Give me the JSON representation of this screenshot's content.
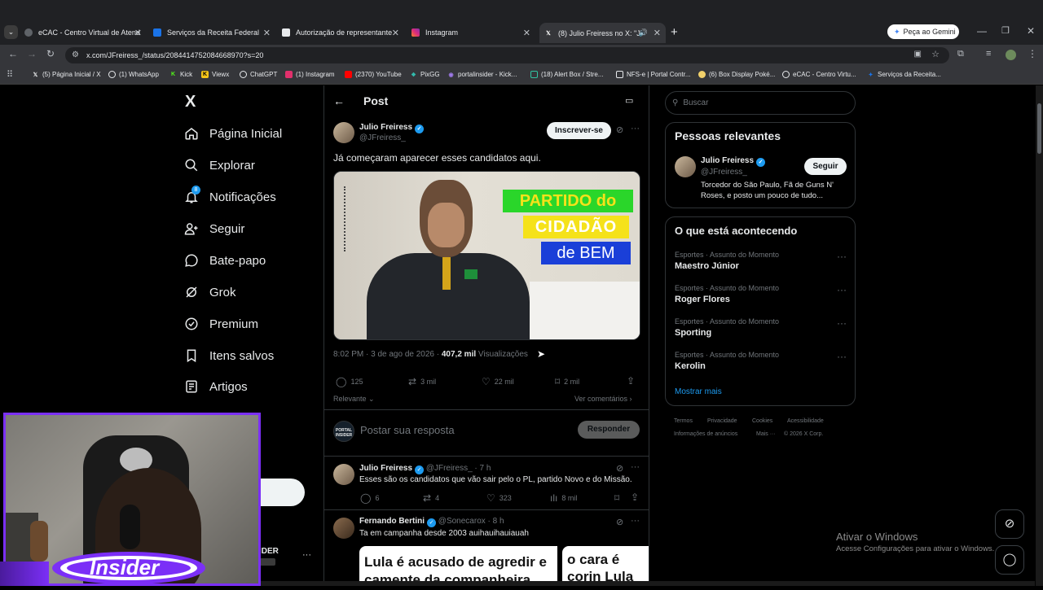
{
  "browser": {
    "tabs": [
      {
        "title": "eCAC - Centro Virtual de Atend",
        "icon": "ecac-icon"
      },
      {
        "title": "Serviços da Receita Federal",
        "icon": "receita-icon"
      },
      {
        "title": "Autorização de representante C",
        "icon": "gov-icon"
      },
      {
        "title": "Instagram",
        "icon": "instagram-icon"
      },
      {
        "title": "(8) Julio Freiress no X: \"Já co",
        "icon": "x-icon"
      }
    ],
    "new_tab": "+",
    "gemini_button": "Peça ao Gemini",
    "url": "x.com/JFreiress_/status/2084414752084668970?s=20",
    "bookmarks": [
      {
        "label": "(5) Página Inicial / X",
        "color": "#e7e9ea"
      },
      {
        "label": "(1) WhatsApp",
        "color": "#25d366"
      },
      {
        "label": "Kick",
        "color": "#53fc18"
      },
      {
        "label": "Viewx",
        "color": "#f5c518"
      },
      {
        "label": "ChatGPT",
        "color": "#e8eaed"
      },
      {
        "label": "(1) Instagram",
        "color": "#e1306c"
      },
      {
        "label": "(2370) YouTube",
        "color": "#ff0000"
      },
      {
        "label": "PixGG",
        "color": "#32bcad"
      },
      {
        "label": "portalinsider - Kick...",
        "color": "#9f7aea"
      },
      {
        "label": "(18) Alert Box / Stre...",
        "color": "#31c3a2"
      },
      {
        "label": "NFS-e | Portal Contr...",
        "color": "#e8eaed"
      },
      {
        "label": "(6) Box Display Poké...",
        "color": "#f2d16b"
      },
      {
        "label": "eCAC - Centro Virtu...",
        "color": "#e8eaed"
      },
      {
        "label": "Serviços da Receita...",
        "color": "#1a73e8"
      }
    ]
  },
  "sidebar": {
    "logo": "X",
    "items": [
      {
        "label": "Página Inicial",
        "icon": "home-icon"
      },
      {
        "label": "Explorar",
        "icon": "search-icon"
      },
      {
        "label": "Notificações",
        "icon": "bell-icon",
        "badge": "8"
      },
      {
        "label": "Seguir",
        "icon": "follow-icon"
      },
      {
        "label": "Bate-papo",
        "icon": "chat-icon"
      },
      {
        "label": "Grok",
        "icon": "grok-icon"
      },
      {
        "label": "Premium",
        "icon": "premium-icon"
      },
      {
        "label": "Itens salvos",
        "icon": "bookmark-icon"
      },
      {
        "label": "Artigos",
        "icon": "articles-icon"
      }
    ],
    "account_partial": "IDER"
  },
  "post": {
    "header": "Post",
    "author": "Julio Freiress",
    "handle": "@JFreiress_",
    "subscribe": "Inscrever-se",
    "text": "Já começaram aparecer esses candidatos aqui.",
    "image_text": {
      "line1": "PARTIDO do",
      "line2": "CIDADÃO",
      "line3": "de BEM"
    },
    "meta_time": "8:02 PM · 3 de ago de 2026 · ",
    "views_count": "407,2 mil",
    "views_label": " Visualizações",
    "replies": "125",
    "reposts": "3 mil",
    "likes": "22 mil",
    "bookmarks": "2 mil",
    "sort": "Relevante",
    "see_comments": "Ver comentários",
    "reply_placeholder": "Postar sua resposta",
    "reply_button": "Responder",
    "reply_avatar_text": "PORTAL INSIDER"
  },
  "replies": [
    {
      "author": "Julio Freiress",
      "handle": "@JFreiress_ · 7 h",
      "text": "Esses são os candidatos que vão sair pelo o PL, partido Novo e do Missão.",
      "replies": "6",
      "reposts": "4",
      "likes": "323",
      "views": "8 mil"
    },
    {
      "author": "Fernando Bertini",
      "handle": "@Sonecarox · 8 h",
      "text": "Ta em campanha desde 2003 auihauihauiauah",
      "card1": "Lula é acusado de agredir e camente da companheira",
      "card2": "o cara é corin Lula sobre pe"
    }
  ],
  "right": {
    "search_placeholder": "Buscar",
    "relevant_title": "Pessoas relevantes",
    "relevant_name": "Julio Freiress",
    "relevant_handle": "@JFreiress_",
    "follow": "Seguir",
    "relevant_bio": "Torcedor do São Paulo, Fã de Guns N' Roses, e posto um pouco de tudo...",
    "trends_title": "O que está acontecendo",
    "trends": [
      {
        "category": "Esportes · Assunto do Momento",
        "name": "Maestro Júnior"
      },
      {
        "category": "Esportes · Assunto do Momento",
        "name": "Roger Flores"
      },
      {
        "category": "Esportes · Assunto do Momento",
        "name": "Sporting"
      },
      {
        "category": "Esportes · Assunto do Momento",
        "name": "Kerolin"
      }
    ],
    "show_more": "Mostrar mais",
    "footer": [
      "Termos",
      "Privacidade",
      "Cookies",
      "Acessibilidade",
      "Informações de anúncios",
      "Mais ···",
      "© 2026 X Corp."
    ]
  },
  "windows": {
    "line1": "Ativar o Windows",
    "line2": "Acesse Configurações para ativar o Windows."
  },
  "overlay": {
    "logo_text": "Insider"
  },
  "colors": {
    "accent": "#1d9bf0",
    "overlay_purple": "#7b2ff7"
  }
}
